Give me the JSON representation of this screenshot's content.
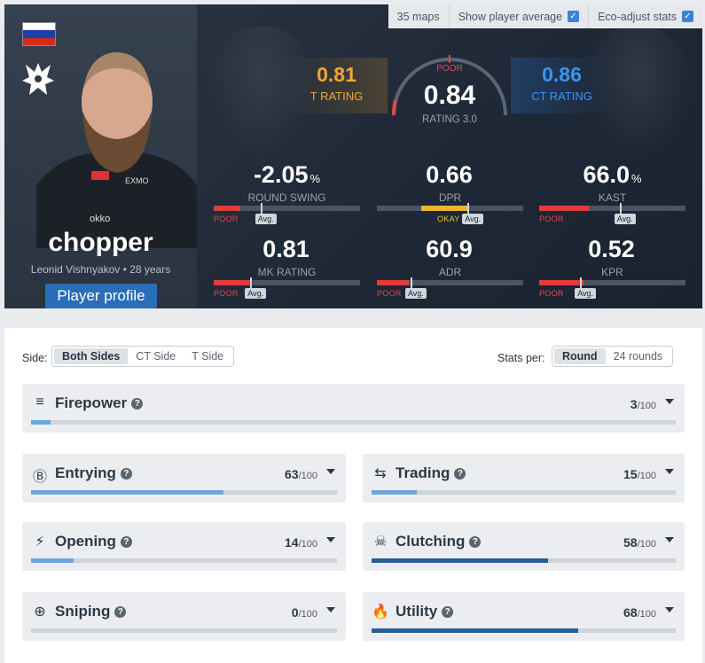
{
  "header_controls": {
    "maps": "35 maps",
    "show_avg_label": "Show player average",
    "eco_adjust_label": "Eco-adjust stats"
  },
  "player": {
    "name": "chopper",
    "real_name_age": "Leonid Vishnyakov • 28 years",
    "profile_button": "Player profile",
    "jersey_texts": [
      "EXMO",
      "okko"
    ]
  },
  "ratings": {
    "t_value": "0.81",
    "t_label": "T RATING",
    "ct_value": "0.86",
    "ct_label": "CT RATING",
    "main_value": "0.84",
    "main_label": "RATING 3.0",
    "main_status": "POOR"
  },
  "stats": [
    {
      "value": "-2.05",
      "unit": "%",
      "label": "ROUND SWING",
      "status": "POOR",
      "avg": "Avg.",
      "fill": 0.18,
      "avg_pos": 0.32,
      "color": "#e03c3c"
    },
    {
      "value": "0.66",
      "unit": "",
      "label": "DPR",
      "status": "OKAY",
      "avg": "Avg.",
      "fill": 0.62,
      "avg_pos": 0.62,
      "color": "#e8b72a"
    },
    {
      "value": "66.0",
      "unit": "%",
      "label": "KAST",
      "status": "POOR",
      "avg": "Avg.",
      "fill": 0.34,
      "avg_pos": 0.55,
      "color": "#e03c3c"
    },
    {
      "value": "0.81",
      "unit": "",
      "label": "MK RATING",
      "status": "POOR",
      "avg": "Avg.",
      "fill": 0.25,
      "avg_pos": 0.25,
      "color": "#e03c3c"
    },
    {
      "value": "60.9",
      "unit": "",
      "label": "ADR",
      "status": "POOR",
      "avg": "Avg.",
      "fill": 0.22,
      "avg_pos": 0.23,
      "color": "#e03c3c"
    },
    {
      "value": "0.52",
      "unit": "",
      "label": "KPR",
      "status": "POOR",
      "avg": "Avg.",
      "fill": 0.3,
      "avg_pos": 0.28,
      "color": "#e03c3c"
    }
  ],
  "filters": {
    "side_label": "Side:",
    "side_options": [
      "Both Sides",
      "CT Side",
      "T Side"
    ],
    "stats_per_label": "Stats per:",
    "stats_per_options": [
      "Round",
      "24 rounds"
    ]
  },
  "categories": [
    {
      "name": "Firepower",
      "score": "3",
      "max": "/100",
      "icon": "firepower-icon",
      "fill": 0.03
    },
    {
      "name": "Entrying",
      "score": "63",
      "max": "/100",
      "icon": "entrying-icon",
      "fill": 0.63
    },
    {
      "name": "Trading",
      "score": "15",
      "max": "/100",
      "icon": "trading-icon",
      "fill": 0.15
    },
    {
      "name": "Opening",
      "score": "14",
      "max": "/100",
      "icon": "opening-icon",
      "fill": 0.14
    },
    {
      "name": "Clutching",
      "score": "58",
      "max": "/100",
      "icon": "clutching-icon",
      "fill": 0.58
    },
    {
      "name": "Sniping",
      "score": "0",
      "max": "/100",
      "icon": "sniping-icon",
      "fill": 0.0
    },
    {
      "name": "Utility",
      "score": "68",
      "max": "/100",
      "icon": "utility-icon",
      "fill": 0.68
    }
  ],
  "colors": {
    "bar_light": "#6aa7e0",
    "bar_dark": "#255f99",
    "accent_blue": "#2a6eb8"
  }
}
